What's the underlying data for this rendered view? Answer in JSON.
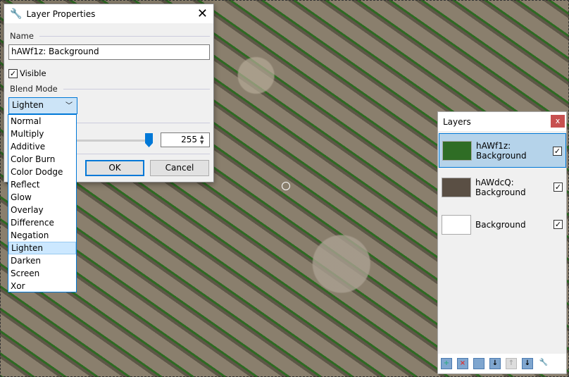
{
  "dialog": {
    "title": "Layer Properties",
    "name_label": "Name",
    "name_value": "hAWf1z: Background",
    "visible_label": "Visible",
    "visible_checked": true,
    "blend_label": "Blend Mode",
    "blend_selected": "Lighten",
    "blend_options": [
      "Normal",
      "Multiply",
      "Additive",
      "Color Burn",
      "Color Dodge",
      "Reflect",
      "Glow",
      "Overlay",
      "Difference",
      "Negation",
      "Lighten",
      "Darken",
      "Screen",
      "Xor"
    ],
    "opacity_value": "255",
    "opacity_fraction": 1.0,
    "ok": "OK",
    "cancel": "Cancel",
    "close": "✕"
  },
  "layers": {
    "title": "Layers",
    "close": "x",
    "items": [
      {
        "name1": "hAWf1z:",
        "name2": "Background",
        "visible": true,
        "selected": true,
        "thumb": "#2f6d25"
      },
      {
        "name1": "hAWdcQ:",
        "name2": "Background",
        "visible": true,
        "selected": false,
        "thumb": "#5a4f44"
      },
      {
        "name1": "",
        "name2": "Background",
        "visible": true,
        "selected": false,
        "thumb": "#ffffff"
      }
    ],
    "toolbar": [
      "add-layer-icon",
      "delete-layer-icon",
      "duplicate-layer-icon",
      "merge-layer-down-icon",
      "move-layer-up-icon",
      "move-layer-down-icon",
      "layer-properties-icon"
    ]
  }
}
